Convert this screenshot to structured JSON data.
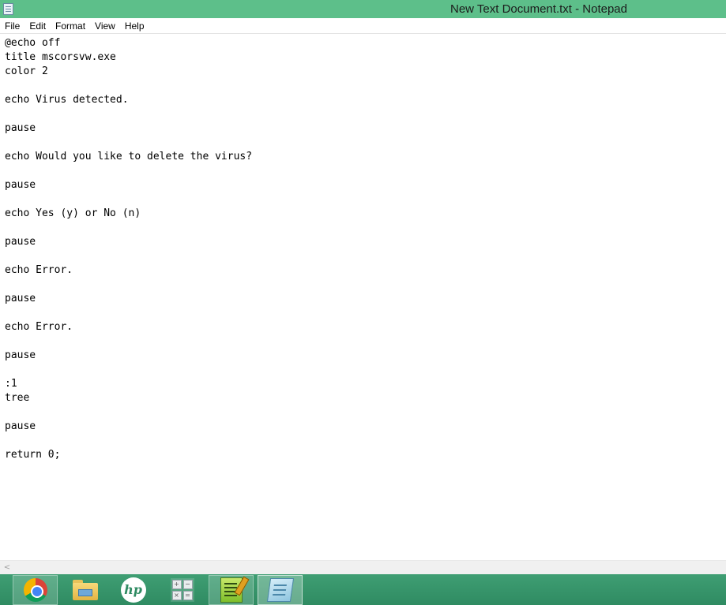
{
  "window": {
    "title": "New Text Document.txt - Notepad",
    "app_icon": "notepad-icon"
  },
  "menu": {
    "items": [
      "File",
      "Edit",
      "Format",
      "View",
      "Help"
    ]
  },
  "editor": {
    "content": "@echo off\ntitle mscorsvw.exe\ncolor 2\n\necho Virus detected.\n\npause\n\necho Would you like to delete the virus?\n\npause\n\necho Yes (y) or No (n)\n\npause\n\necho Error.\n\npause\n\necho Error.\n\npause\n\n:1\ntree\n\npause\n\nreturn 0;"
  },
  "scrollbar": {
    "left_arrow": "<"
  },
  "taskbar": {
    "apps": [
      {
        "name": "chrome",
        "icon": "chrome-icon",
        "state": "pinned"
      },
      {
        "name": "file-explorer",
        "icon": "folder-icon",
        "state": "pinned"
      },
      {
        "name": "hp",
        "icon": "hp-icon",
        "label": "hp",
        "state": "pinned"
      },
      {
        "name": "calculator",
        "icon": "calculator-icon",
        "state": "pinned"
      },
      {
        "name": "notepad-plus-plus",
        "icon": "notepad-plus-plus-icon",
        "state": "pinned"
      },
      {
        "name": "notepad",
        "icon": "notepad-icon",
        "state": "active"
      }
    ],
    "calc_keys": [
      "+",
      "−",
      "×",
      "="
    ]
  },
  "colors": {
    "titlebar": "#5dbf8a",
    "taskbar": "#3f9e73"
  }
}
